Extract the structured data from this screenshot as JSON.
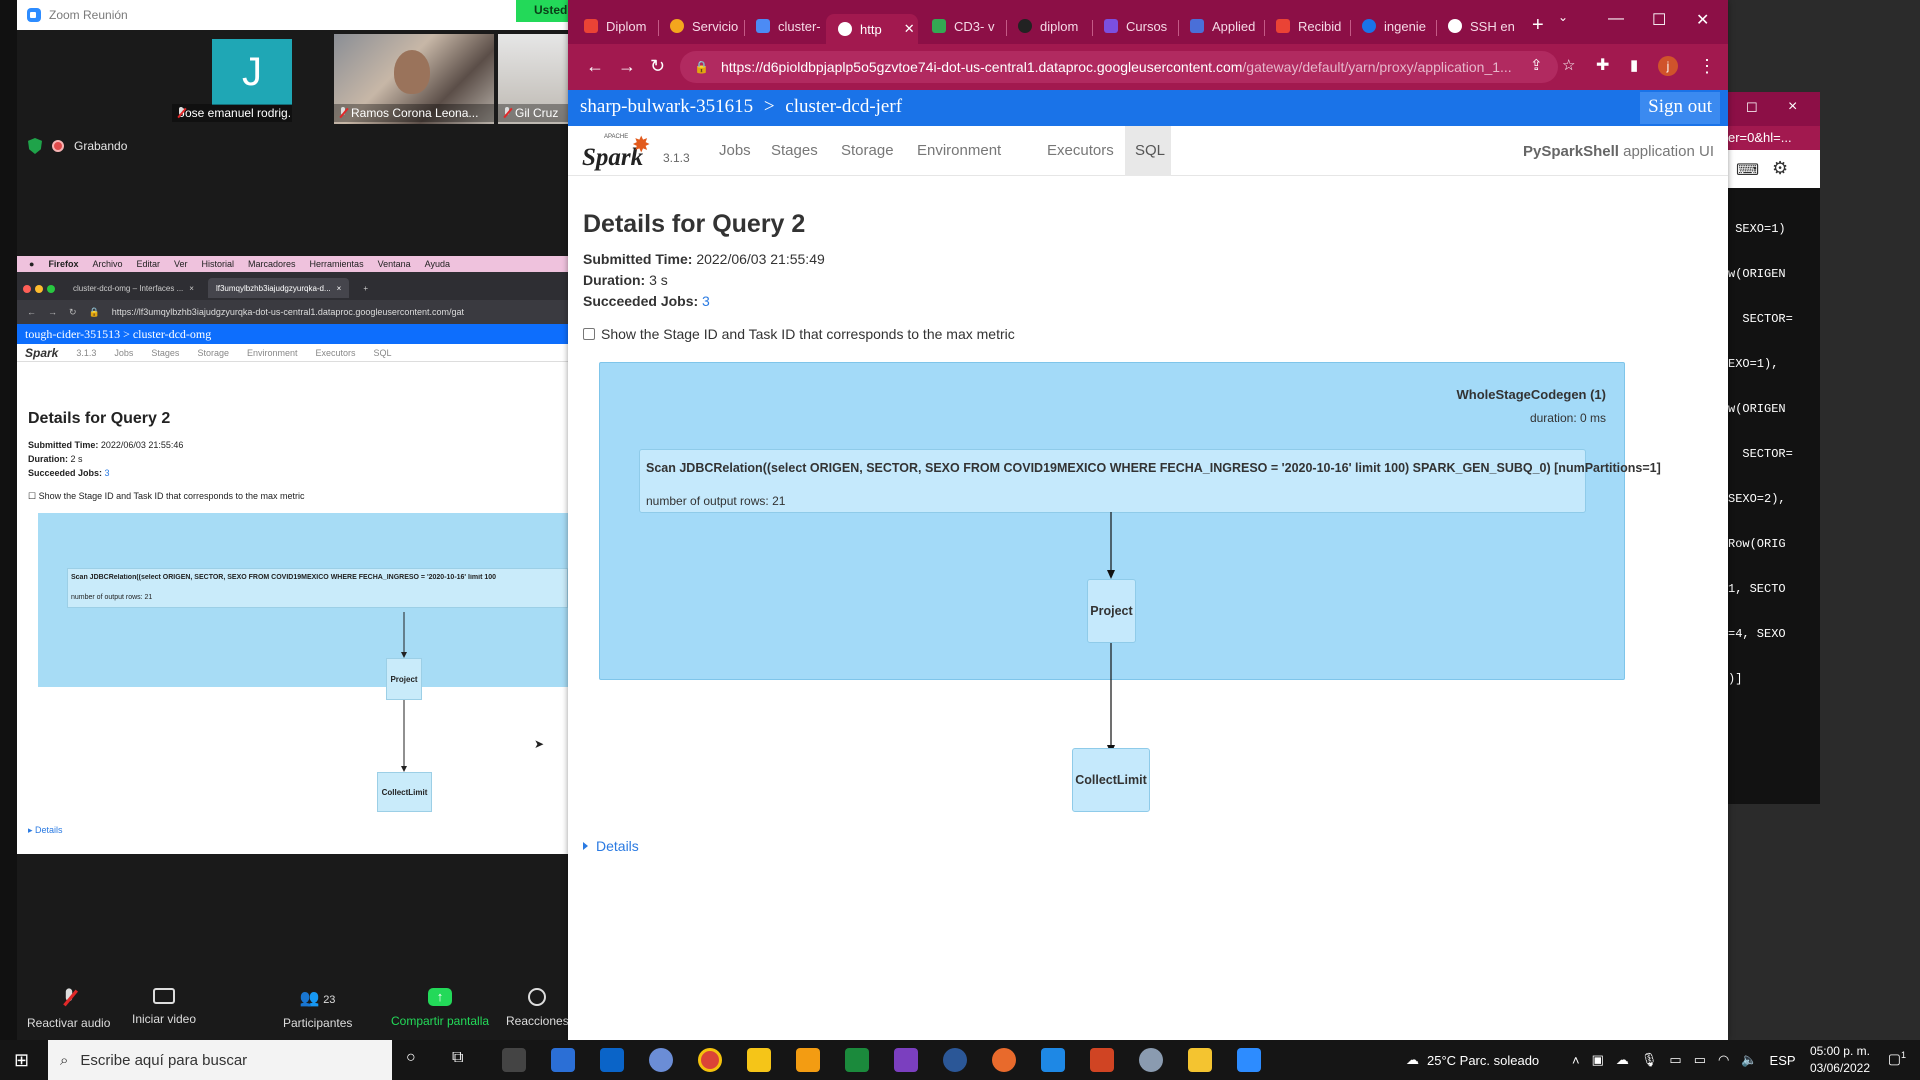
{
  "zoom": {
    "title": "Zoom Reunión",
    "sharing_badge": "Usted",
    "participants": [
      {
        "name": "Jose emanuel rodrig...",
        "initial": "J"
      },
      {
        "name": "Ramos Corona Leona..."
      },
      {
        "name": "Gil Cruz"
      }
    ],
    "recording": "Grabando",
    "shared_screen": {
      "menubar": [
        "Firefox",
        "Archivo",
        "Editar",
        "Ver",
        "Historial",
        "Marcadores",
        "Herramientas",
        "Ventana",
        "Ayuda"
      ],
      "tabs": [
        "cluster-dcd-omg – Interfaces ...",
        "lf3umqylbzhb3iajudgzyurqka-d..."
      ],
      "url": "https://lf3umqylbzhb3iajudgzyurqka-dot-us-central1.dataproc.googleusercontent.com/gat",
      "breadcrumb": "tough-cider-351513 > cluster-dcd-omg",
      "spark_version": "3.1.3",
      "nav": [
        "Jobs",
        "Stages",
        "Storage",
        "Environment",
        "Executors",
        "SQL"
      ],
      "title": "Details for Query 2",
      "submitted_label": "Submitted Time:",
      "submitted_value": "2022/06/03 21:55:46",
      "duration_label": "Duration:",
      "duration_value": "2 s",
      "jobs_label": "Succeeded Jobs:",
      "jobs_value": "3",
      "checkbox_label": "Show the Stage ID and Task ID that corresponds to the max metric",
      "scan_text": "Scan JDBCRelation((select ORIGEN, SECTOR, SEXO FROM COVID19MEXICO WHERE FECHA_INGRESO = '2020-10-16' limit 100",
      "scan_metric": "number of output rows: 21",
      "node_project": "Project",
      "node_collect": "CollectLimit",
      "details": "Details"
    },
    "toolbar": [
      {
        "label": "Reactivar audio",
        "icon": "mic-off-icon"
      },
      {
        "label": "Iniciar video",
        "icon": "video-off-icon"
      },
      {
        "label": "Participantes",
        "icon": "participants-icon",
        "count": "23"
      },
      {
        "label": "Compartir pantalla",
        "icon": "share-screen-icon"
      },
      {
        "label": "Reacciones",
        "icon": "reactions-icon"
      }
    ]
  },
  "browser": {
    "tabs": [
      {
        "label": "Diplom",
        "icon": "gmail-icon",
        "color": "#ea4335"
      },
      {
        "label": "Servicio",
        "icon": "cloud-icon",
        "color": "#f4a61d"
      },
      {
        "label": "cluster-",
        "icon": "dataproc-icon",
        "color": "#4c8bf5"
      },
      {
        "label": "http",
        "icon": "google-icon",
        "color": "#ffffff"
      },
      {
        "label": "CD3- v",
        "icon": "drive-icon",
        "color": "#34a853"
      },
      {
        "label": "diplom",
        "icon": "github-icon",
        "color": "#222222"
      },
      {
        "label": "Cursos",
        "icon": "cursos-icon",
        "color": "#7b4fe0"
      },
      {
        "label": "Applied",
        "icon": "applied-icon",
        "color": "#4a6fd8"
      },
      {
        "label": "Recibid",
        "icon": "gmail-icon",
        "color": "#ea4335"
      },
      {
        "label": "ingenie",
        "icon": "chegg-icon",
        "color": "#1a73e8"
      },
      {
        "label": "SSH en",
        "icon": "google-icon",
        "color": "#ffffff"
      }
    ],
    "url_host": "https://d6pioldbpjaplp5o5gzvtoe74i-dot-us-central1.dataproc.googleusercontent.com",
    "url_path": "/gateway/default/yarn/proxy/application_1...",
    "accent": "#8c0f46",
    "profile_initial": "j"
  },
  "dataproc": {
    "project": "sharp-bulwark-351615",
    "separator": ">",
    "cluster": "cluster-dcd-jerf",
    "sign_out": "Sign out"
  },
  "spark": {
    "version": "3.1.3",
    "nav": [
      "Jobs",
      "Stages",
      "Storage",
      "Environment",
      "Executors",
      "SQL"
    ],
    "active_nav": "SQL",
    "app_name": "PySparkShell",
    "app_suffix": "application UI"
  },
  "query": {
    "title": "Details for Query 2",
    "submitted_label": "Submitted Time:",
    "submitted_value": "2022/06/03 21:55:49",
    "duration_label": "Duration:",
    "duration_value": "3 s",
    "jobs_label": "Succeeded Jobs:",
    "jobs_value": "3",
    "checkbox_label": "Show the Stage ID and Task ID that corresponds to the max metric",
    "codegen_title": "WholeStageCodegen (1)",
    "codegen_duration": "duration: 0 ms",
    "scan_text": "Scan JDBCRelation((select ORIGEN, SECTOR, SEXO FROM COVID19MEXICO WHERE FECHA_INGRESO = '2020-10-16' limit 100) SPARK_GEN_SUBQ_0) [numPartitions=1]",
    "scan_metric": "number of output rows: 21",
    "node_project": "Project",
    "node_collect": "CollectLimit",
    "details": "Details"
  },
  "background_window": {
    "tab_text": "er=0&hl=...",
    "code_lines": [
      " SEXO=1)",
      "w(ORIGEN",
      "  SECTOR=",
      "EXO=1),",
      "w(ORIGEN",
      "  SECTOR=",
      "SEXO=2),",
      "Row(ORIG",
      "1, SECTO",
      "=4, SEXO",
      ")]"
    ]
  },
  "taskbar": {
    "search_placeholder": "Escribe aquí para buscar",
    "weather": "25°C  Parc. soleado",
    "language": "ESP",
    "time": "05:00 p. m.",
    "date": "03/06/2022",
    "notifications": "1"
  }
}
